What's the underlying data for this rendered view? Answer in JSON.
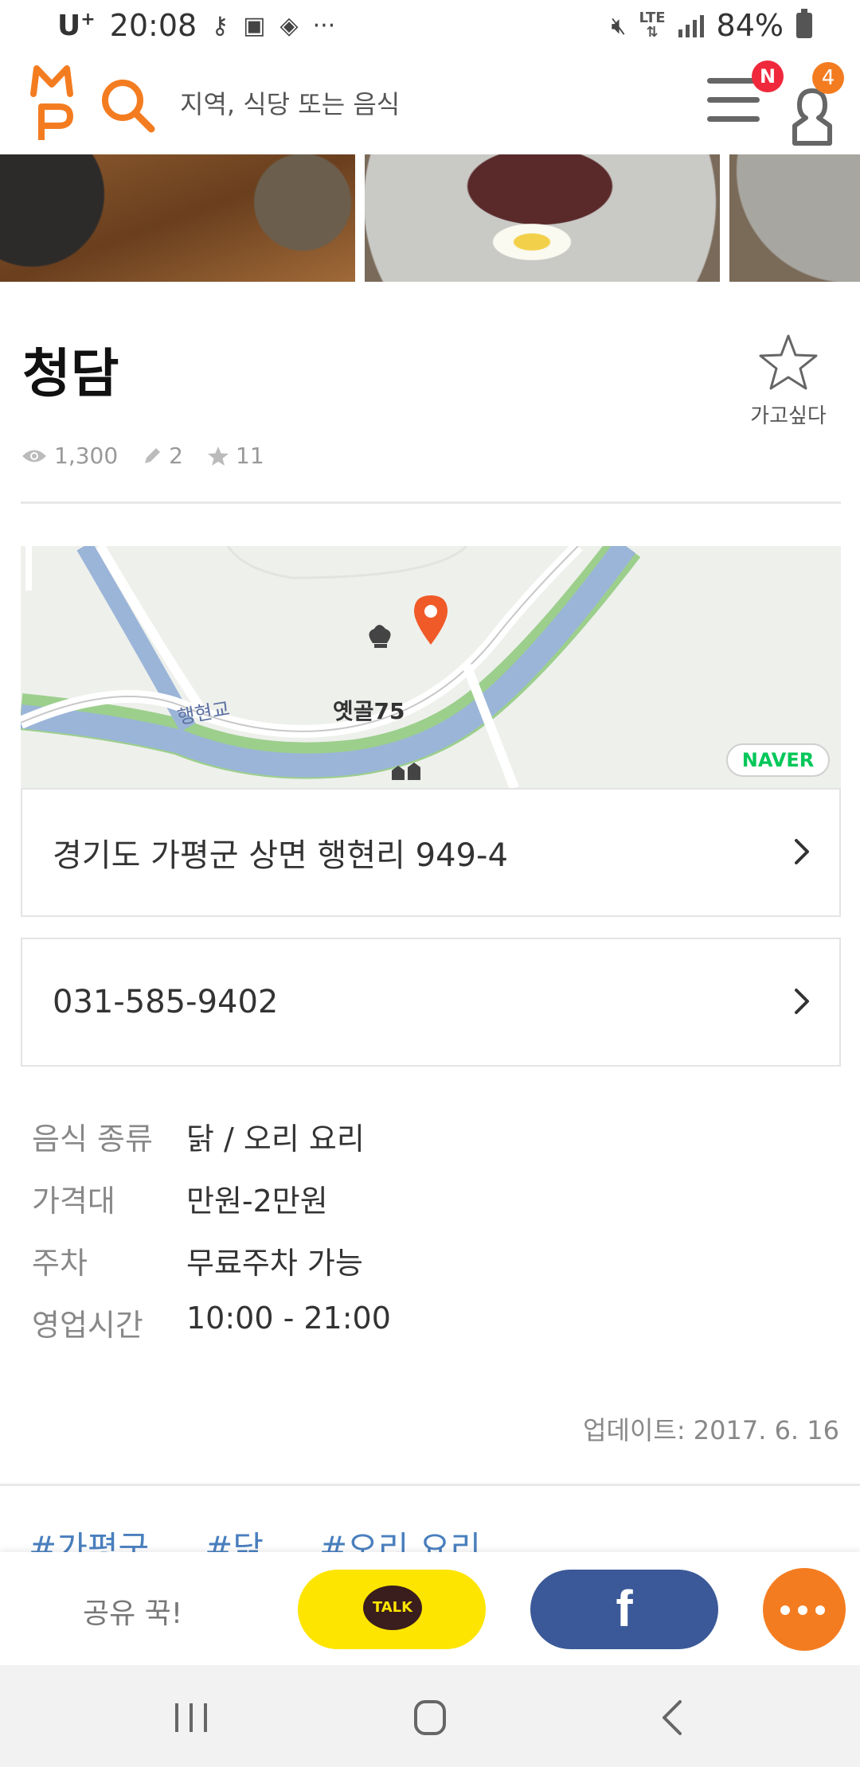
{
  "status_bar": {
    "carrier": "U",
    "carrier_sup": "+",
    "time": "20:08",
    "notification_icons": [
      "key-icon",
      "image-icon",
      "pill-icon",
      "more-icon"
    ],
    "network": "LTE",
    "battery": "84%"
  },
  "header": {
    "logo": "MP",
    "search_placeholder": "지역, 식당 또는 음식",
    "menu_badge": "N",
    "user_badge": "4",
    "accent_color": "#f47c20"
  },
  "restaurant": {
    "name": "청담",
    "wish_label": "가고싶다",
    "views": "1,300",
    "reviews": "2",
    "wishes": "11"
  },
  "map": {
    "place_label": "옛골75",
    "road_label": "행현교",
    "provider": "NAVER"
  },
  "address": "경기도 가평군 상면 행현리 949-4",
  "phone": "031-585-9402",
  "details": [
    {
      "label": "음식 종류",
      "value": "닭 / 오리 요리"
    },
    {
      "label": "가격대",
      "value": "만원-2만원"
    },
    {
      "label": "주차",
      "value": "무료주차 가능"
    },
    {
      "label": "영업시간",
      "value": "10:00 - 21:00"
    }
  ],
  "updated": "업데이트: 2017. 6. 16",
  "tags": [
    "#가평군",
    "#닭",
    "#오리 요리"
  ],
  "share": {
    "label": "공유 꾹!",
    "kakao_label": "TALK",
    "facebook_label": "f"
  }
}
